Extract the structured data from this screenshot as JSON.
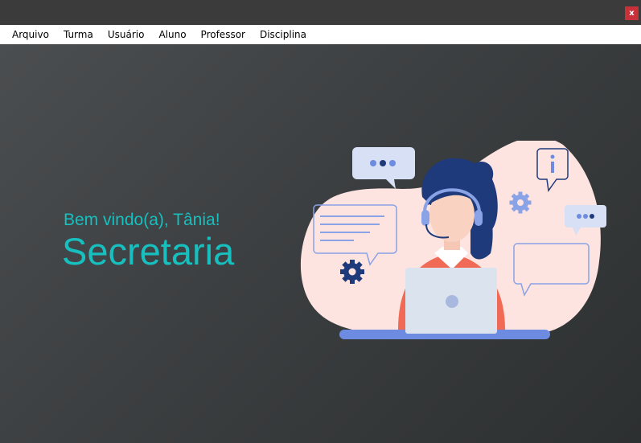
{
  "window": {
    "close_label": "x"
  },
  "menu": {
    "items": [
      "Arquivo",
      "Turma",
      "Usuário",
      "Aluno",
      "Professor",
      "Disciplina"
    ]
  },
  "main": {
    "welcome_text": "Bem vindo(a), Tânia!",
    "role_text": "Secretaria"
  },
  "colors": {
    "accent_text": "#17bfbf",
    "close_button": "#c9313a",
    "blob": "#fde4e0",
    "shirt": "#f06a55",
    "hair": "#1e3a7a",
    "laptop": "#dbe3ee",
    "desk": "#6d8be0"
  },
  "illustration": {
    "icon_names": [
      "customer-support-agent",
      "chat-bubble-dots-icon",
      "info-bubble-icon",
      "gear-icon",
      "message-lines-icon",
      "laptop-icon"
    ]
  }
}
